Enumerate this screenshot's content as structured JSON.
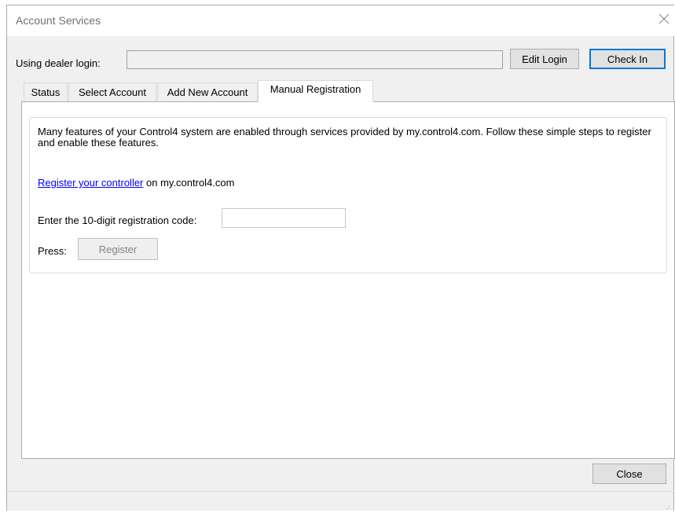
{
  "window": {
    "title": "Account Services"
  },
  "login": {
    "label": "Using dealer login:",
    "value": "",
    "edit_login_label": "Edit Login",
    "check_in_label": "Check In"
  },
  "tabs": [
    {
      "label": "Status",
      "active": false
    },
    {
      "label": "Select Account",
      "active": false
    },
    {
      "label": "Add New Account",
      "active": false
    },
    {
      "label": "Manual Registration",
      "active": true
    }
  ],
  "manual_registration": {
    "intro_text": "Many features of your Control4 system are enabled through services provided by my.control4.com. Follow these simple steps to register and enable these features.",
    "register_link_text": "Register your controller",
    "register_link_suffix": " on my.control4.com",
    "code_label": "Enter the 10-digit registration code:",
    "code_value": "",
    "press_label": "Press:",
    "register_button_label": "Register"
  },
  "footer": {
    "close_label": "Close"
  },
  "icons": {
    "close": "close-icon",
    "resize_grip": "resize-grip-icon"
  },
  "colors": {
    "link": "#0000ff",
    "default_button_border": "#0078d7",
    "window_background": "#f0f0f0"
  }
}
